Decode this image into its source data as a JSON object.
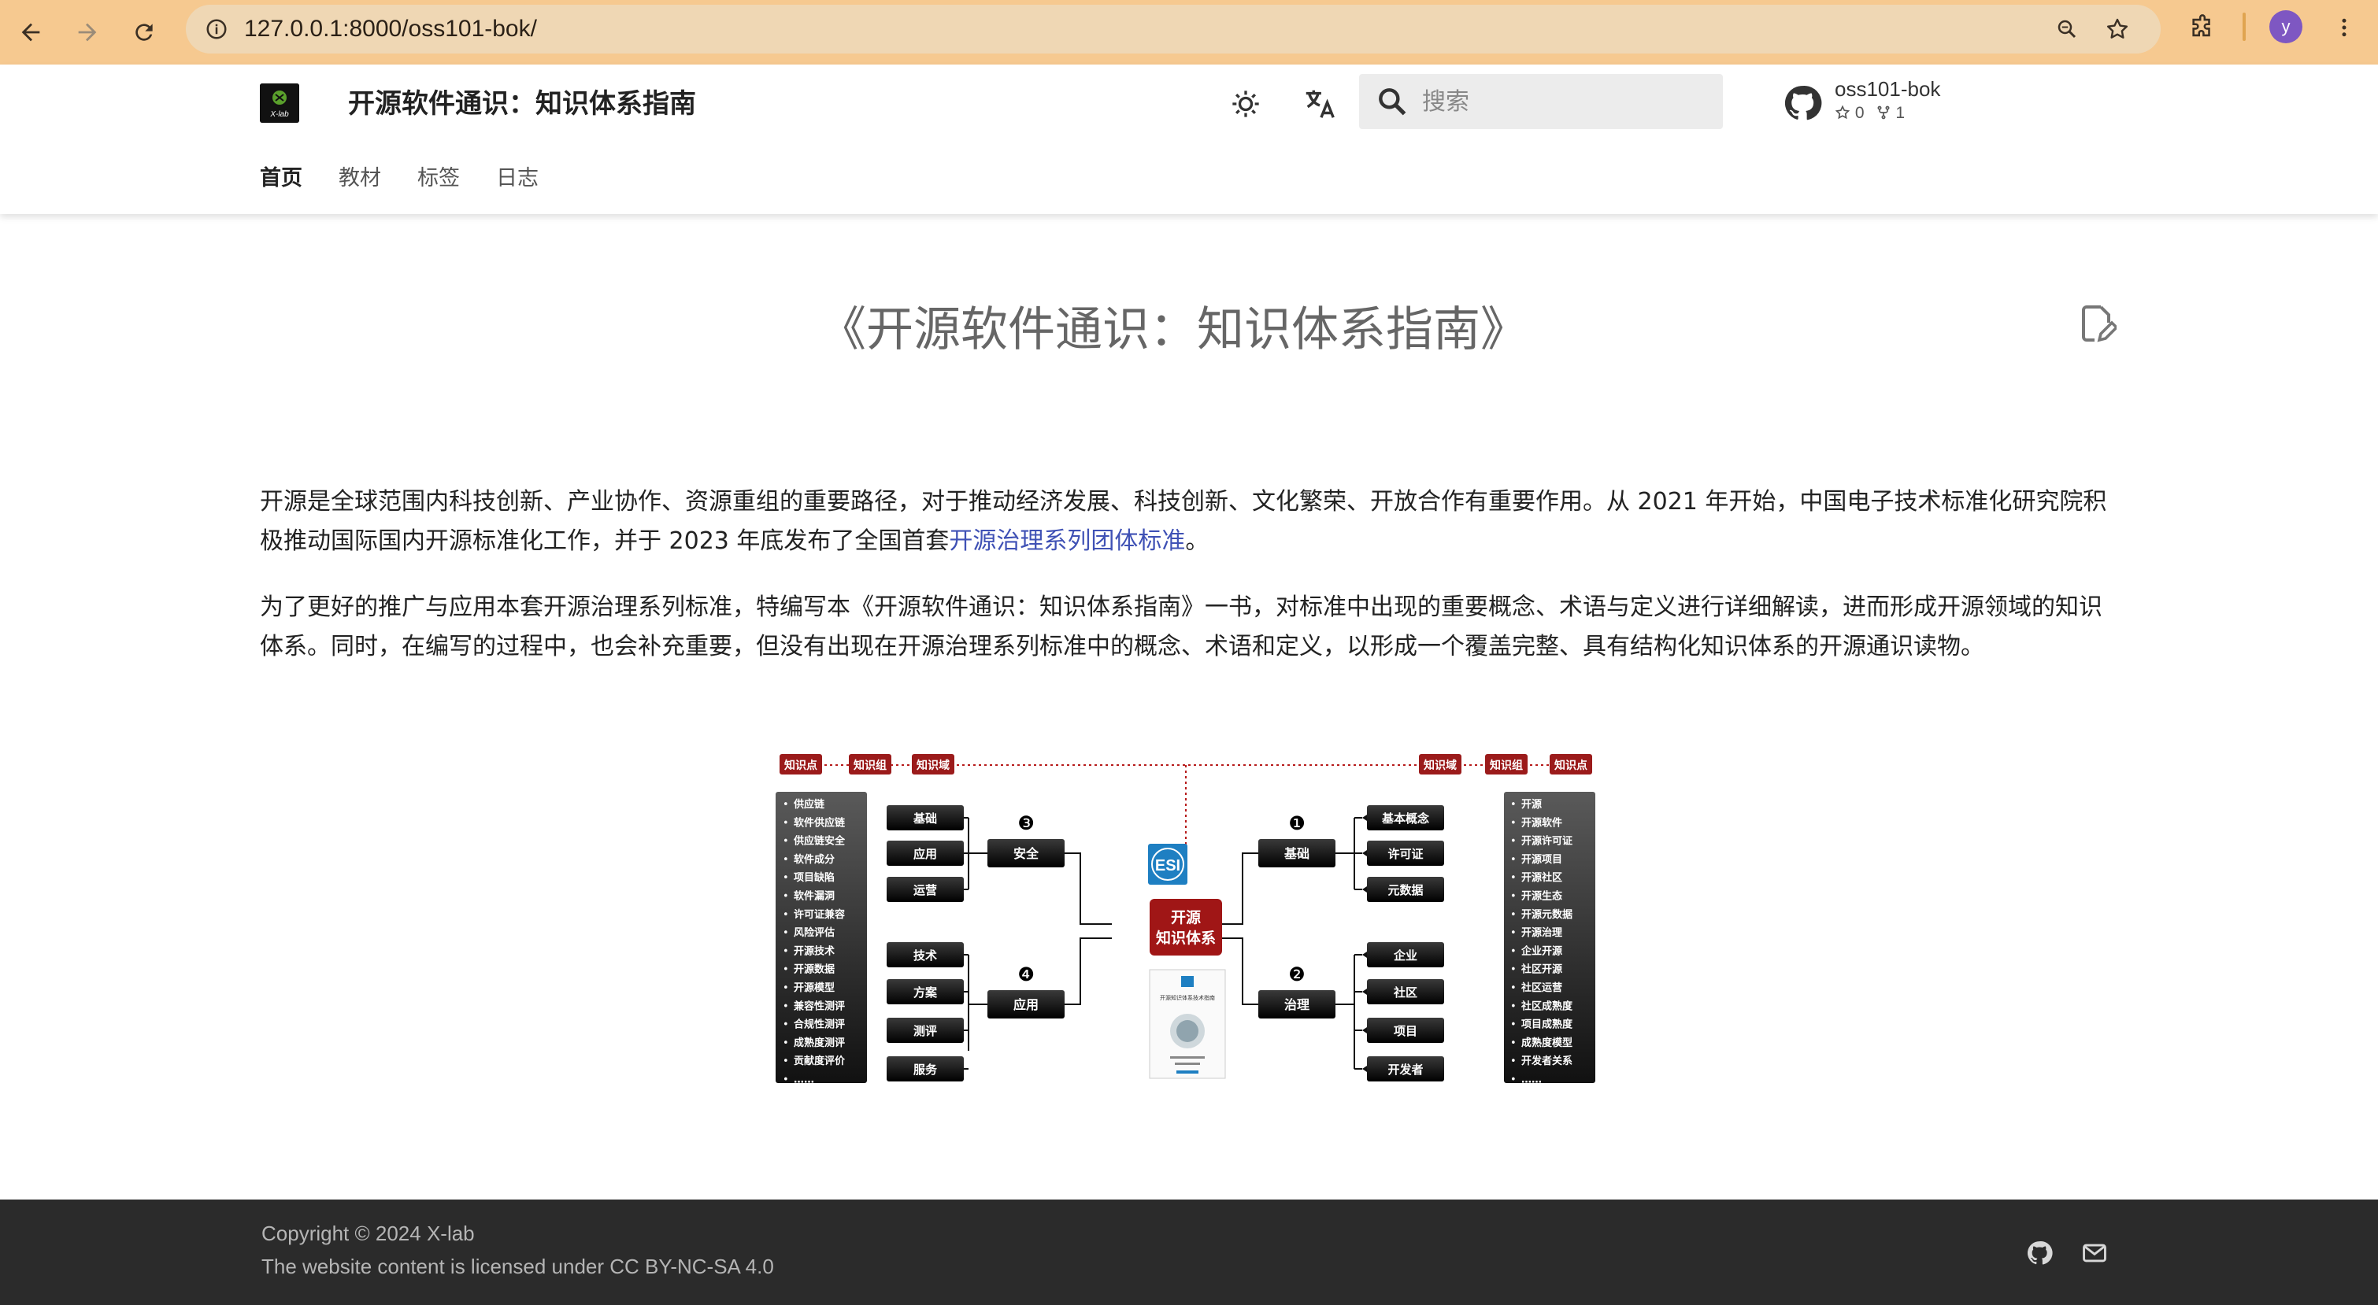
{
  "browser": {
    "url": "127.0.0.1:8000/oss101-bok/",
    "profile_initial": "y",
    "back_icon": "arrow-left-icon",
    "forward_icon": "arrow-right-icon",
    "reload_icon": "reload-icon"
  },
  "header": {
    "site_title": "开源软件通识：知识体系指南",
    "logo_text": "X-lab",
    "search_placeholder": "搜索",
    "repo": {
      "name": "oss101-bok",
      "stars": "0",
      "forks": "1"
    },
    "tabs": [
      {
        "label": "首页",
        "active": true
      },
      {
        "label": "教材"
      },
      {
        "label": "标签"
      },
      {
        "label": "日志"
      }
    ]
  },
  "main": {
    "title": "《开源软件通识：知识体系指南》",
    "para1_text": "开源是全球范围内科技创新、产业协作、资源重组的重要路径，对于推动经济发展、科技创新、文化繁荣、开放合作有重要作用。从 2021 年开始，中国电子技术标准化研究院积极推动国际国内开源标准化工作，并于 2023 年底发布了全国首套",
    "para1_link": "开源治理系列团体标准",
    "para1_end": "。",
    "para2": "为了更好的推广与应用本套开源治理系列标准，特编写本《开源软件通识：知识体系指南》一书，对标准中出现的重要概念、术语与定义进行详细解读，进而形成开源领域的知识体系。同时，在编写的过程中，也会补充重要，但没有出现在开源治理系列标准中的概念、术语和定义，以形成一个覆盖完整、具有结构化知识体系的开源通识读物。"
  },
  "diagram": {
    "header_tags": [
      "知识点",
      "知识组",
      "知识域",
      "知识域",
      "知识组",
      "知识点"
    ],
    "center_line1": "开源",
    "center_line2": "知识体系",
    "esi_label": "ESI",
    "domains": [
      {
        "num": "❶",
        "label": "基础",
        "groups": [
          "基本概念",
          "许可证",
          "元数据"
        ]
      },
      {
        "num": "❷",
        "label": "治理",
        "groups": [
          "企业",
          "社区",
          "项目",
          "开发者"
        ]
      },
      {
        "num": "❸",
        "label": "安全",
        "groups": [
          "基础",
          "应用",
          "运营"
        ]
      },
      {
        "num": "❹",
        "label": "应用",
        "groups": [
          "技术",
          "方案",
          "测评",
          "服务"
        ]
      }
    ],
    "left_points": [
      "供应链",
      "软件供应链",
      "供应链安全",
      "软件成分",
      "项目缺陷",
      "软件漏洞",
      "许可证兼容",
      "风险评估",
      "开源技术",
      "开源数据",
      "开源模型",
      "兼容性测评",
      "合规性测评",
      "成熟度测评",
      "贡献度评价",
      "……"
    ],
    "right_points": [
      "开源",
      "开源软件",
      "开源许可证",
      "开源项目",
      "开源社区",
      "开源生态",
      "开源元数据",
      "开源治理",
      "企业开源",
      "社区开源",
      "社区运营",
      "社区成熟度",
      "项目成熟度",
      "成熟度模型",
      "开发者关系",
      "……"
    ],
    "book_title": "开源知识体系技术指南"
  },
  "footer": {
    "copyright": "Copyright © 2024 X-lab",
    "license": "The website content is licensed under CC BY-NC-SA 4.0"
  }
}
